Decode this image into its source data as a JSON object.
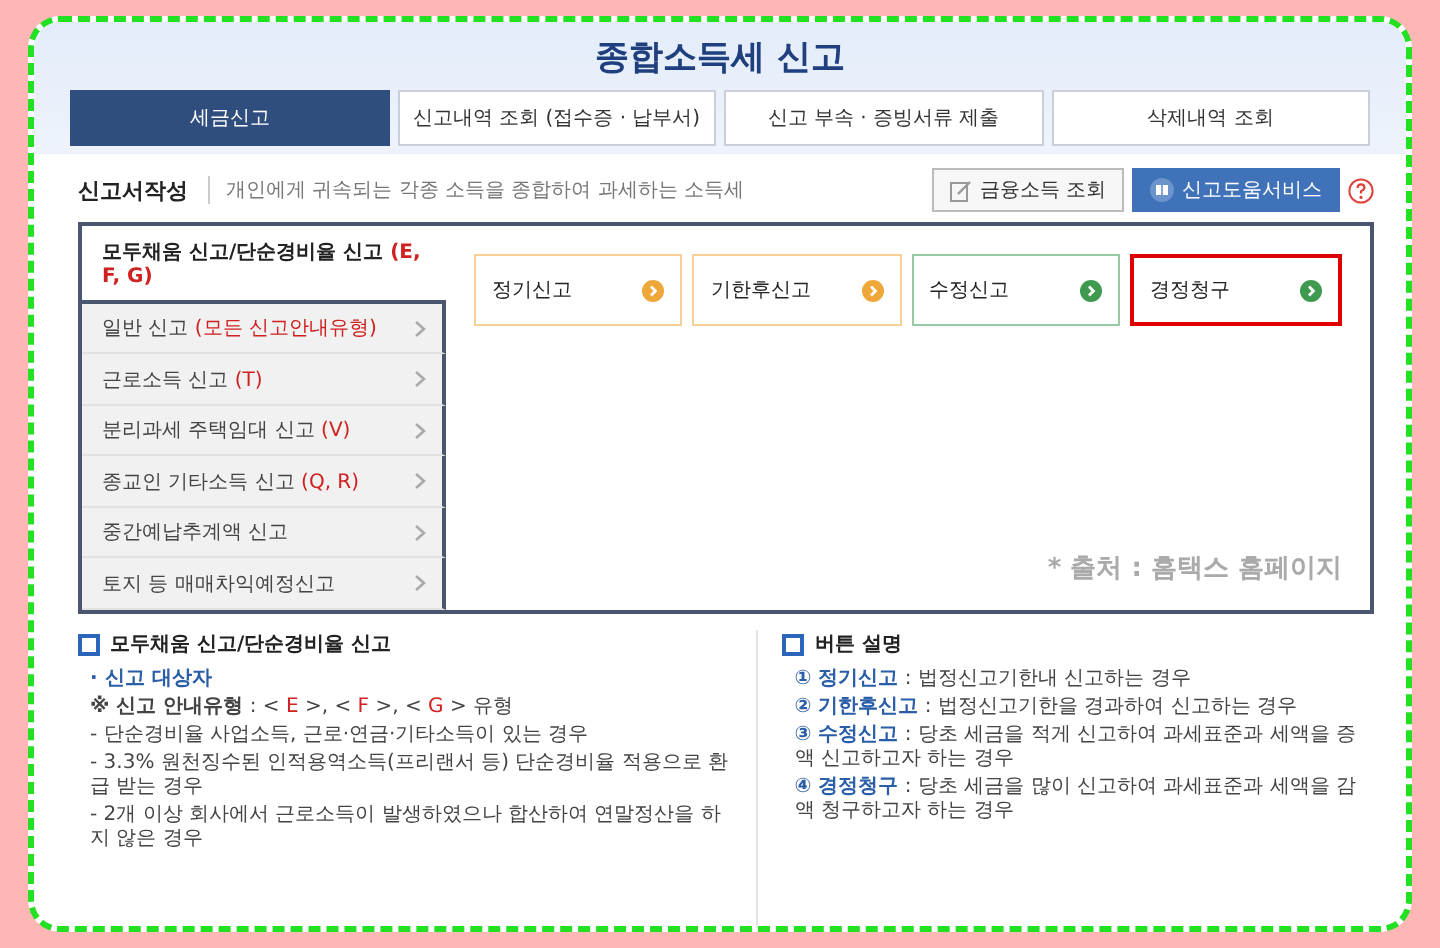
{
  "page_title": "종합소득세 신고",
  "tabs": [
    {
      "label": "세금신고",
      "selected": true
    },
    {
      "label": "신고내역 조회 (접수증 · 납부서)",
      "selected": false
    },
    {
      "label": "신고 부속 · 증빙서류 제출",
      "selected": false
    },
    {
      "label": "삭제내역 조회",
      "selected": false
    }
  ],
  "section": {
    "title": "신고서작성",
    "description": "개인에게 귀속되는 각종 소득을 종합하여 과세하는 소득세"
  },
  "actions": [
    {
      "label": "금융소득 조회",
      "kind": "plain"
    },
    {
      "label": "신고도움서비스",
      "kind": "primary"
    }
  ],
  "menu": [
    {
      "runs": [
        {
          "text": "모두채움 신고/단순경비율 신고 "
        },
        {
          "text": "(E, F, G)",
          "color": "#d02020"
        }
      ],
      "selected": true
    },
    {
      "runs": [
        {
          "text": "일반 신고 "
        },
        {
          "text": "(모든 신고안내유형)",
          "color": "#d02020"
        }
      ],
      "selected": false
    },
    {
      "runs": [
        {
          "text": "근로소득 신고 "
        },
        {
          "text": "(T)",
          "color": "#d02020"
        }
      ],
      "selected": false
    },
    {
      "runs": [
        {
          "text": "분리과세 주택임대 신고 "
        },
        {
          "text": "(V)",
          "color": "#d02020"
        }
      ],
      "selected": false
    },
    {
      "runs": [
        {
          "text": "종교인 기타소득 신고 "
        },
        {
          "text": "(Q, R)",
          "color": "#d02020"
        }
      ],
      "selected": false
    },
    {
      "runs": [
        {
          "text": "중간예납추계액 신고"
        }
      ],
      "selected": false
    },
    {
      "runs": [
        {
          "text": "토지 등 매매차익예정신고"
        }
      ],
      "selected": false
    }
  ],
  "cards": [
    {
      "label": "정기신고",
      "color": "#f0a73a",
      "highlighted": false
    },
    {
      "label": "기한후신고",
      "color": "#f0a73a",
      "highlighted": false
    },
    {
      "label": "수정신고",
      "color": "#3f9a50",
      "highlighted": false
    },
    {
      "label": "경정청구",
      "color": "#3f9a50",
      "highlighted": true
    }
  ],
  "source_note": "* 출처 : 홈택스 홈페이지",
  "info_left": {
    "title": "모두채움 신고/단순경비율 신고",
    "lines": [
      [
        {
          "text": "· 신고 대상자",
          "color": "#2a5ea8",
          "bold": true
        }
      ],
      [
        {
          "text": "※ 신고 안내유형",
          "bold": true
        },
        {
          "text": " : < ",
          "bold": false
        },
        {
          "text": "E",
          "color": "#d02020",
          "bold": false
        },
        {
          "text": " >, < ",
          "bold": false
        },
        {
          "text": "F",
          "color": "#d02020",
          "bold": false
        },
        {
          "text": " >, < ",
          "bold": false
        },
        {
          "text": "G",
          "color": "#d02020",
          "bold": false
        },
        {
          "text": " > 유형",
          "bold": false
        }
      ],
      [
        {
          "text": "- 단순경비율 사업소득, 근로·연금·기타소득이 있는 경우",
          "bold": false
        }
      ],
      [
        {
          "text": "- 3.3% 원천징수된 인적용역소득(프리랜서 등) 단순경비율 적용으로 환급 받는 경우",
          "bold": false
        }
      ],
      [
        {
          "text": "- 2개 이상 회사에서 근로소득이 발생하였으나 합산하여 연말정산을 하지 않은 경우",
          "bold": false
        }
      ]
    ]
  },
  "info_right": {
    "title": "버튼 설명",
    "lines": [
      [
        {
          "text": "① 정기신고",
          "color": "#2a5ea8",
          "bold": true
        },
        {
          "text": " : 법정신고기한내 신고하는 경우",
          "bold": false
        }
      ],
      [
        {
          "text": "② 기한후신고",
          "color": "#2a5ea8",
          "bold": true
        },
        {
          "text": " : 법정신고기한을 경과하여 신고하는 경우",
          "bold": false
        }
      ],
      [
        {
          "text": "③ 수정신고",
          "color": "#2a5ea8",
          "bold": true
        },
        {
          "text": " : 당초 세금을 적게 신고하여 과세표준과 세액을 증액 신고하고자 하는 경우",
          "bold": false
        }
      ],
      [
        {
          "text": "④ 경정청구",
          "color": "#2a5ea8",
          "bold": true
        },
        {
          "text": " : 당초 세금을 많이 신고하여 과세표준과 세액을 감액 청구하고자 하는 경우",
          "bold": false
        }
      ]
    ]
  }
}
